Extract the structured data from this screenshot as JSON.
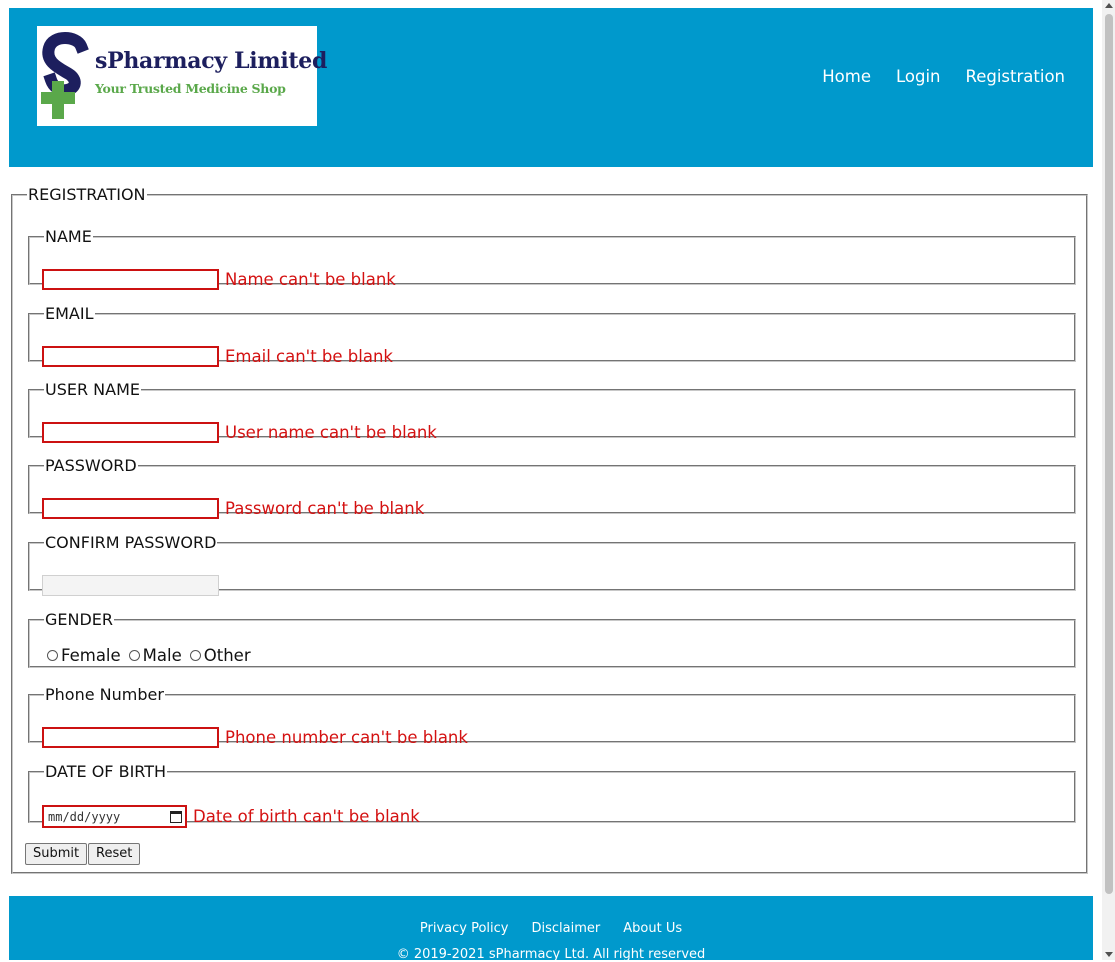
{
  "brand": {
    "name": "sPharmacy Limited",
    "tagline": "Your Trusted Medicine Shop",
    "logo_colors": {
      "letter": "#1d1f5e",
      "cross": "#5aa84a"
    }
  },
  "nav": {
    "items": [
      "Home",
      "Login",
      "Registration"
    ]
  },
  "form": {
    "legend": "REGISTRATION",
    "fields": {
      "name": {
        "legend": "NAME",
        "value": "",
        "error": "Name can't be blank"
      },
      "email": {
        "legend": "EMAIL",
        "value": "",
        "error": "Email can't be blank"
      },
      "username": {
        "legend": "USER NAME",
        "value": "",
        "error": "User name can't be blank"
      },
      "password": {
        "legend": "PASSWORD",
        "value": "",
        "error": "Password can't be blank"
      },
      "confirm_password": {
        "legend": "CONFIRM PASSWORD",
        "value": ""
      },
      "gender": {
        "legend": "GENDER",
        "options": [
          "Female",
          "Male",
          "Other"
        ],
        "selected": null
      },
      "phone": {
        "legend": "Phone Number",
        "value": "",
        "error": "Phone number can't be blank"
      },
      "dob": {
        "legend": "DATE OF BIRTH",
        "placeholder": "mm/dd/yyyy",
        "error": "Date of birth can't be blank"
      }
    },
    "buttons": {
      "submit": "Submit",
      "reset": "Reset"
    }
  },
  "footer": {
    "links": [
      "Privacy Policy",
      "Disclaimer",
      "About Us"
    ],
    "copyright": "© 2019-2021 sPharmacy Ltd. All right reserved"
  },
  "colors": {
    "header_bg": "#0099cc",
    "error": "#d41111",
    "input_error_border": "#cc1111"
  }
}
